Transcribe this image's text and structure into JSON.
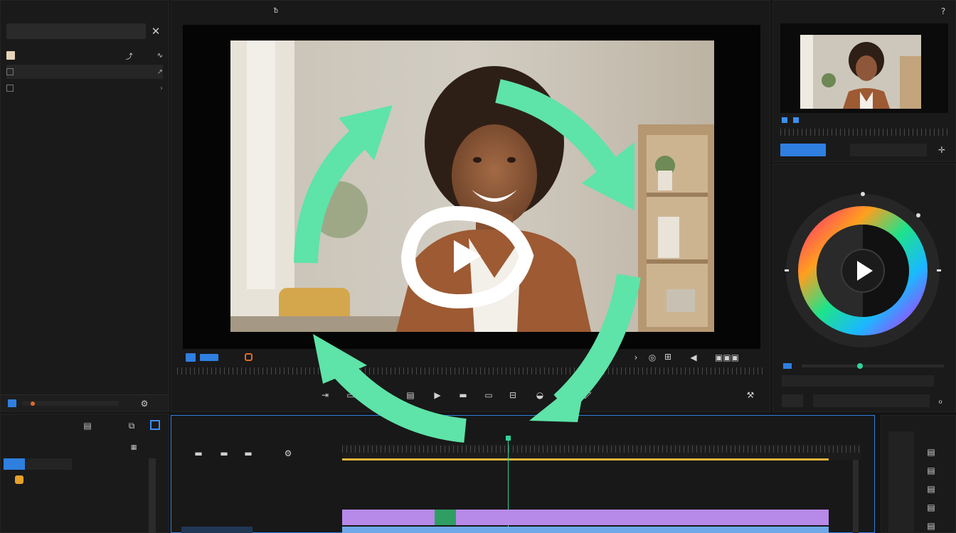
{
  "media_panel": {
    "title": "",
    "search_label": "",
    "items": [
      "",
      "",
      ""
    ]
  },
  "program": {
    "title": "",
    "tab": ""
  },
  "source": {
    "title": "",
    "color_title": ""
  },
  "project": {
    "title": "",
    "bin": "",
    "items": [
      "",
      "",
      "",
      "",
      ""
    ]
  },
  "timeline": {
    "title": "",
    "sub": ""
  },
  "icons": {
    "close": "close-icon",
    "play": "play-icon",
    "refresh": "loop-arrows-icon",
    "color_wheel": "color-wheel-icon"
  },
  "colors": {
    "accent_blue": "#2f7fe0",
    "arrow_green": "#5ee3a8",
    "clip_purple": "#b789e8",
    "clip_blue": "#6fa8e8",
    "playhead": "#2fd39a",
    "work_area": "#e0b43a"
  }
}
